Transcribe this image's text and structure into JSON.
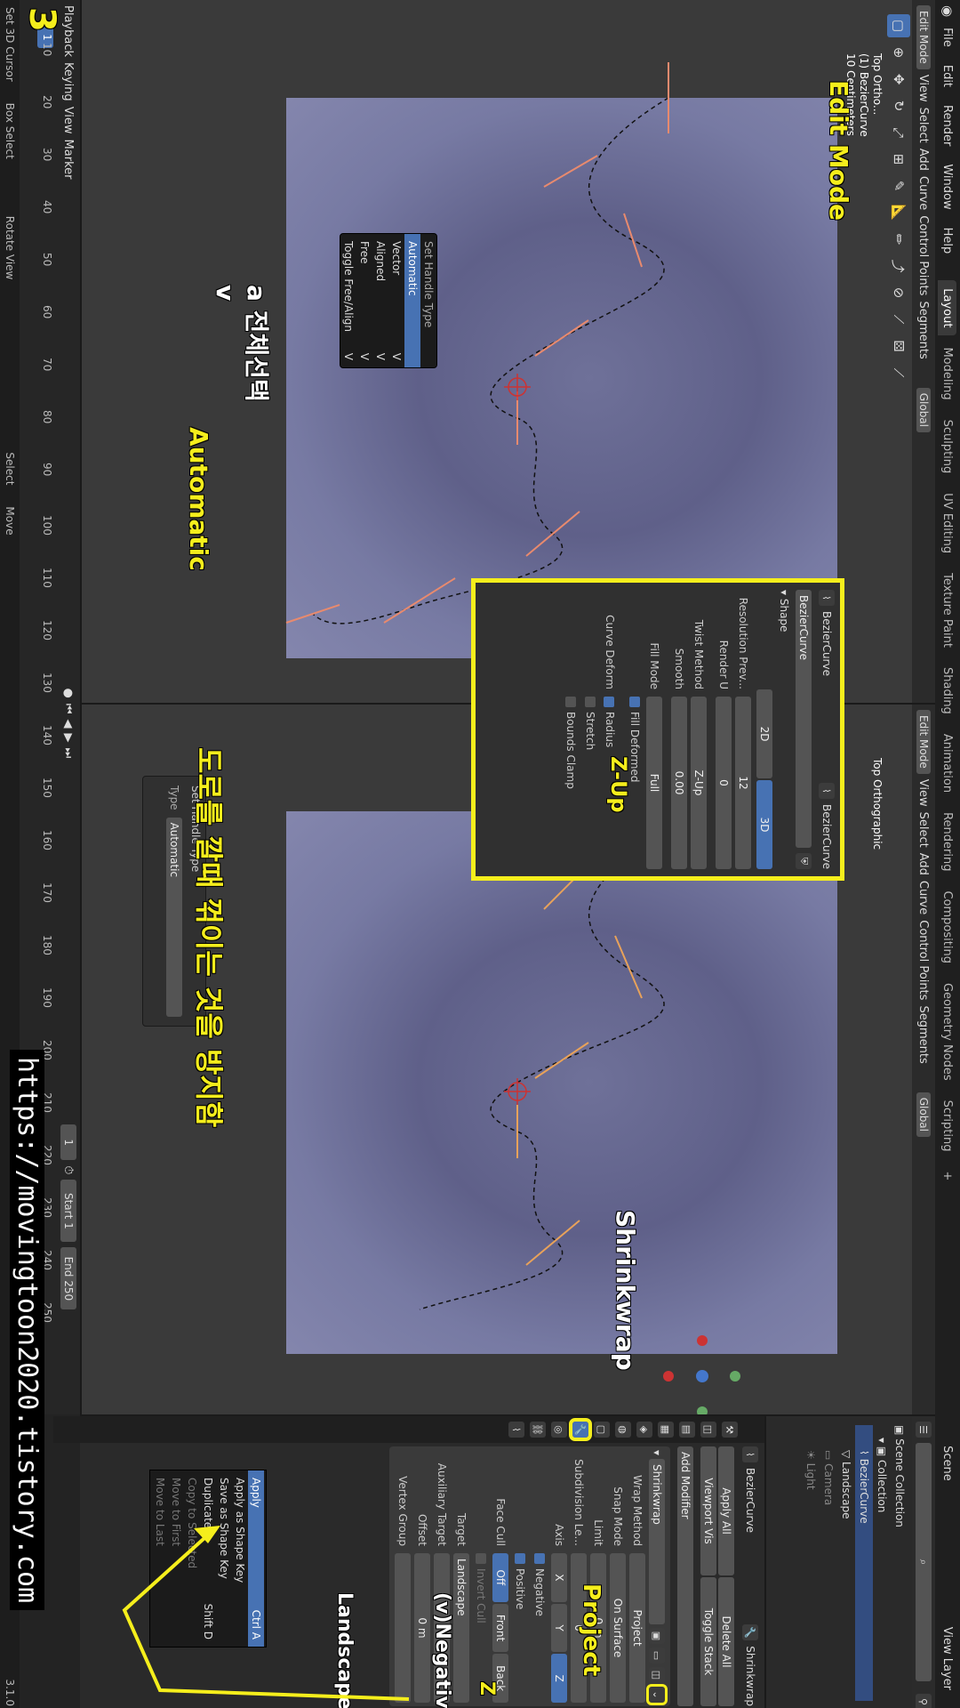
{
  "app": {
    "menus": [
      "File",
      "Edit",
      "Render",
      "Window",
      "Help"
    ],
    "workspaces": [
      "Layout",
      "Modeling",
      "Sculpting",
      "UV Editing",
      "Texture Paint",
      "Shading",
      "Animation",
      "Rendering",
      "Compositing",
      "Geometry Nodes",
      "Scripting"
    ],
    "active_workspace": "Layout",
    "scene_label": "Scene",
    "view_layer_label": "View Layer",
    "version": "3.1.0"
  },
  "viewport_left": {
    "mode": "Edit Mode",
    "menus": [
      "View",
      "Select",
      "Add",
      "Curve",
      "Control Points",
      "Segments"
    ],
    "transform": "Global",
    "overlay_lines": [
      "Top Ortho...",
      "(1) BezierCurve",
      "10 Centimeters"
    ],
    "set_handle_menu": {
      "title": "Set Handle Type",
      "items": [
        {
          "label": "Automatic",
          "shortcut": "",
          "highlight": true
        },
        {
          "label": "Vector",
          "shortcut": "V",
          "highlight": false
        },
        {
          "label": "Aligned",
          "shortcut": "V",
          "highlight": false
        },
        {
          "label": "Free",
          "shortcut": "V",
          "highlight": false
        },
        {
          "label": "Toggle Free/Align",
          "shortcut": "V",
          "highlight": false
        }
      ]
    }
  },
  "viewport_right": {
    "mode": "Edit Mode",
    "menus": [
      "View",
      "Select",
      "Add",
      "Curve",
      "Control Points",
      "Segments"
    ],
    "transform": "Global",
    "overlay_lines": [
      "Top Orthographic"
    ],
    "last_op": {
      "title": "Set Handle Type",
      "type_label": "Type",
      "type_value": "Automatic"
    }
  },
  "curve_panel": {
    "object_name": "BezierCurve",
    "data_name": "BezierCurve",
    "section": "Shape",
    "dim_2d": "2D",
    "dim_3d": "3D",
    "resolution_preview_label": "Resolution Prev...",
    "resolution_preview_value": "12",
    "render_u_label": "Render U",
    "render_u_value": "0",
    "twist_method_label": "Twist Method",
    "twist_method_value": "Z-Up",
    "smooth_label": "Smooth",
    "smooth_value": "0.00",
    "fill_mode_label": "Fill Mode",
    "fill_mode_value": "Full",
    "fill_deformed": "Fill Deformed",
    "curve_deform_label": "Curve Deform",
    "radius": "Radius",
    "stretch": "Stretch",
    "bounds_clamp": "Bounds Clamp"
  },
  "outliner": {
    "items": [
      "Scene Collection",
      "Collection",
      "BezierCurve",
      "Landscape",
      "Camera",
      "Light"
    ]
  },
  "modifier_panel": {
    "object_name": "BezierCurve",
    "modifier_name_field": "Shrinkwrap",
    "add_modifier": "Add Modifier",
    "apply_all": "Apply All",
    "delete_all": "Delete All",
    "viewport_vis": "Viewport Vis",
    "toggle_stack": "Toggle Stack",
    "modifier": "Shrinkwrap",
    "wrap_method_label": "Wrap Method",
    "wrap_method_value": "Project",
    "snap_mode_label": "Snap Mode",
    "snap_mode_value": "On Surface",
    "limit_label": "Limit",
    "limit_value": "0 m",
    "subdivision_label": "Subdivision Le...",
    "subdivision_value": "0",
    "axis_label": "Axis",
    "axes": [
      "X",
      "Y",
      "Z"
    ],
    "negative": "Negative",
    "positive": "Positive",
    "face_cull_label": "Face Cull",
    "face_cull_off": "Off",
    "face_cull_front": "Front",
    "face_cull_back": "Back",
    "invert_cull": "Invert Cull",
    "target_label": "Target",
    "target_value": "Landscape",
    "aux_target_label": "Auxiliary Target",
    "offset_label": "Offset",
    "offset_value": "0 m",
    "vertex_group_label": "Vertex Group",
    "context_menu": [
      {
        "label": "Apply",
        "shortcut": "Ctrl A",
        "highlight": true
      },
      {
        "label": "Apply as Shape Key",
        "shortcut": "",
        "highlight": false
      },
      {
        "label": "Save as Shape Key",
        "shortcut": "",
        "highlight": false
      },
      {
        "label": "Duplicate",
        "shortcut": "Shift D",
        "highlight": false
      },
      {
        "label": "Copy to Selected",
        "shortcut": "",
        "highlight": false
      },
      {
        "label": "Move to First",
        "shortcut": "",
        "highlight": false
      },
      {
        "label": "Move to Last",
        "shortcut": "",
        "highlight": false
      }
    ]
  },
  "timeline": {
    "menus": [
      "Playback",
      "Keying",
      "View",
      "Marker"
    ],
    "ticks": [
      "10",
      "20",
      "30",
      "40",
      "50",
      "60",
      "70",
      "80",
      "90",
      "100",
      "110",
      "120",
      "130",
      "140",
      "150",
      "160",
      "170",
      "180",
      "190",
      "200",
      "210",
      "220",
      "230",
      "240",
      "250"
    ],
    "current_frame": "1",
    "start_label": "Start",
    "start_value": "1",
    "end_label": "End",
    "end_value": "250"
  },
  "statusbar": {
    "items": [
      "Set 3D Cursor",
      "Box Select",
      "Rotate View",
      "Select",
      "Move"
    ]
  },
  "annotations": {
    "step": "3",
    "edit_mode": "Edit Mode",
    "select_all": "a 전체선택",
    "v_key": "v",
    "automatic": "Automatic",
    "z_up": "Z-Up",
    "caption": "도로를 깔때 꺾이는 것을 방지함",
    "shrinkwrap": "Shrinkwrap",
    "project": "Project",
    "negative": "(v)Negative",
    "z": "Z",
    "landscape": "Landscape",
    "url": "https://movingtoon2020.tistory.com"
  },
  "colors": {
    "accent": "#4772b3",
    "annotation": "#f5ee1c",
    "handle_selected": "#e88a6e",
    "handle_auto": "#e8a25a"
  }
}
